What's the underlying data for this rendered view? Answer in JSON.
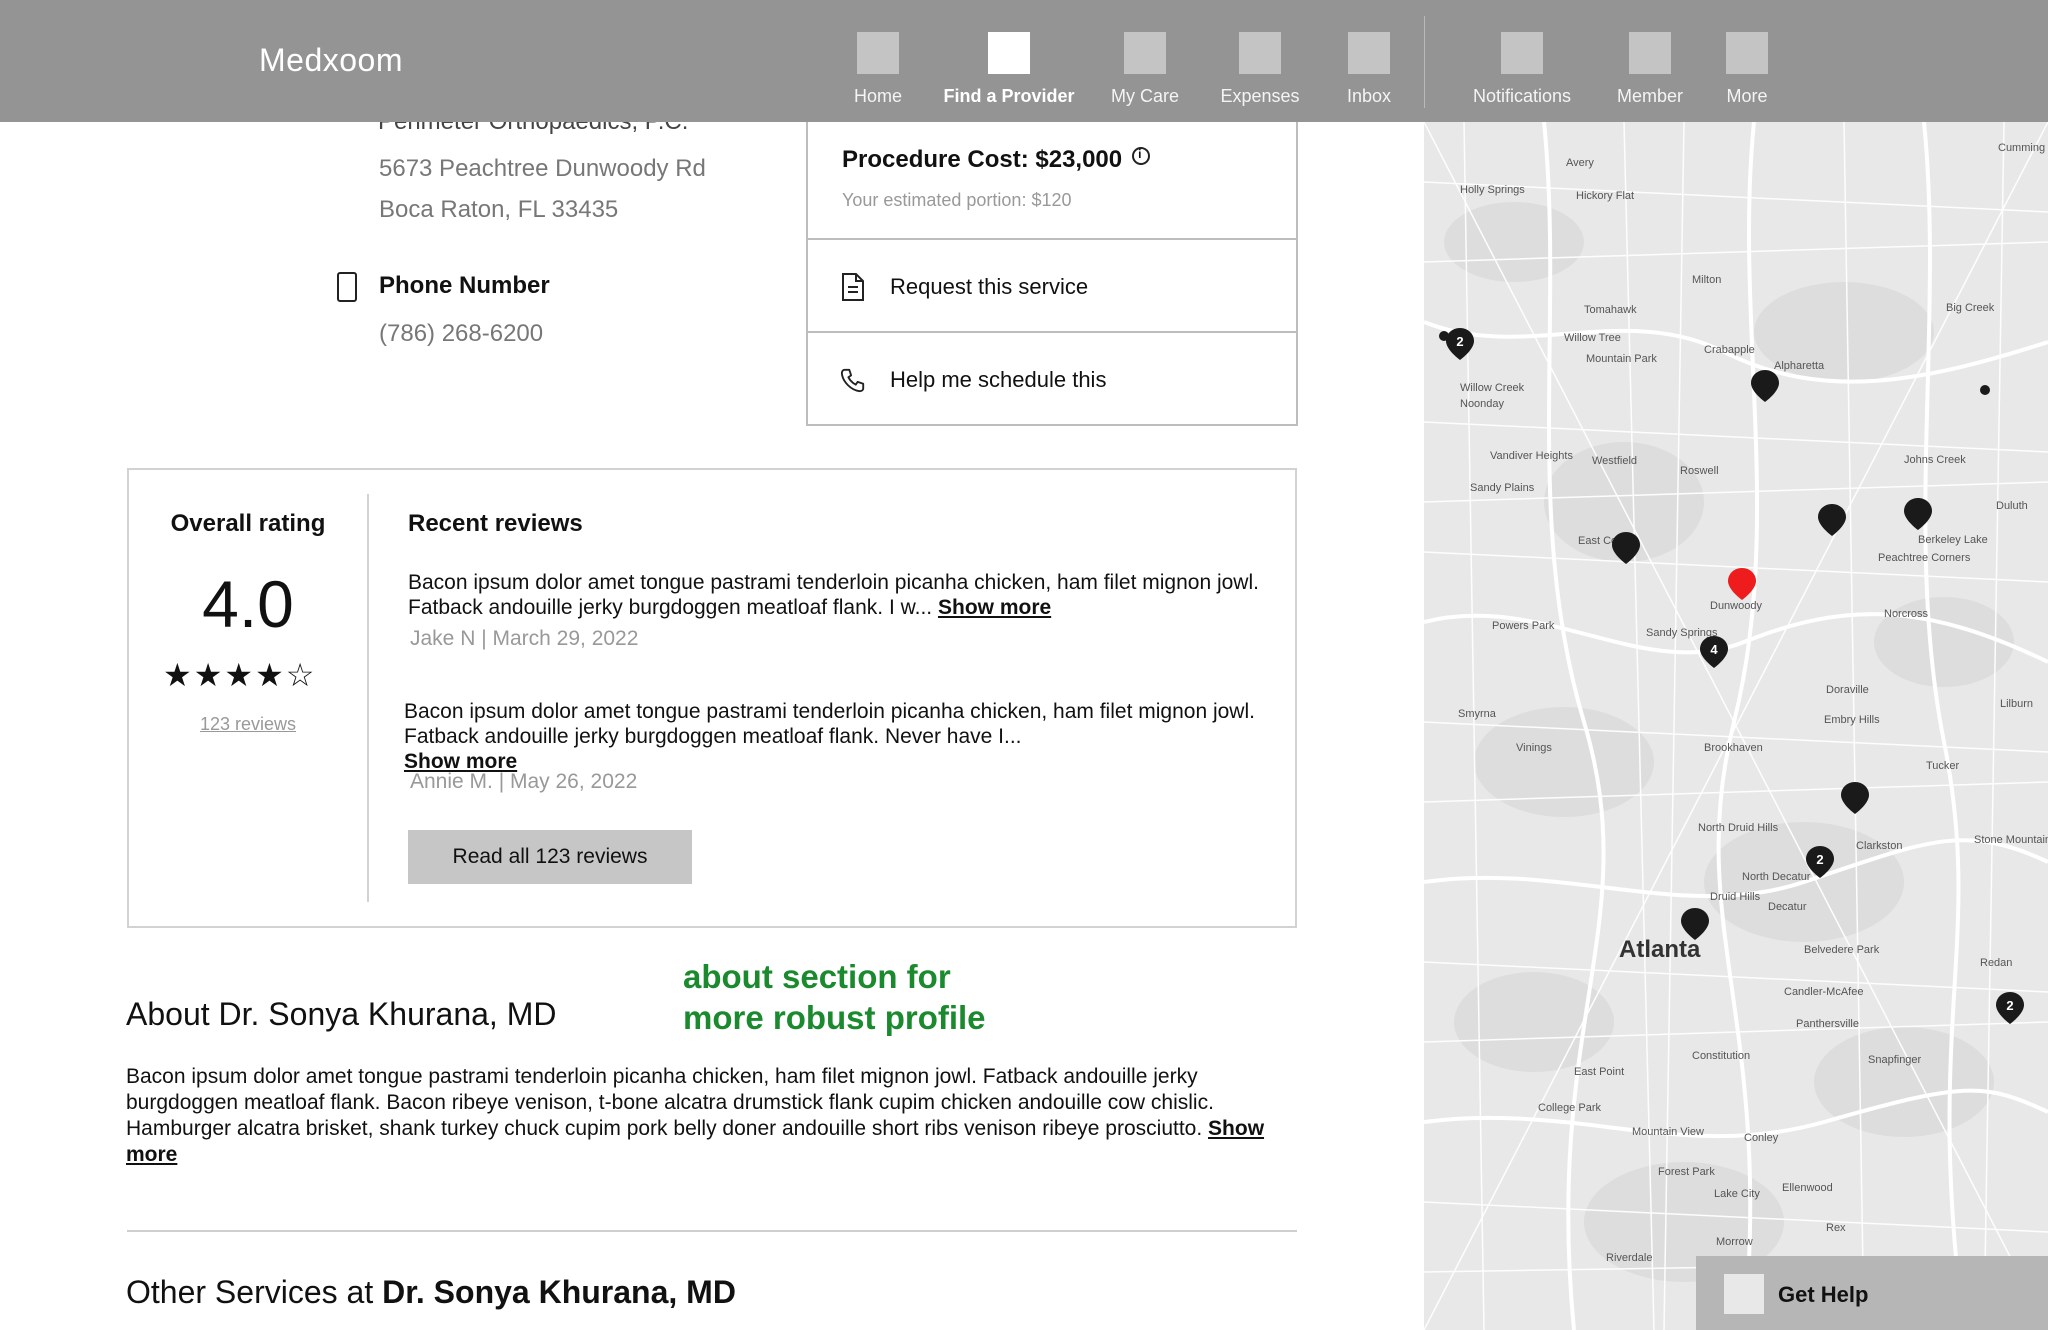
{
  "app": {
    "name": "Medxoom"
  },
  "nav": {
    "items": [
      {
        "label": "Home",
        "active": false
      },
      {
        "label": "Find a Provider",
        "active": true
      },
      {
        "label": "My Care",
        "active": false
      },
      {
        "label": "Expenses",
        "active": false
      },
      {
        "label": "Inbox",
        "active": false
      },
      {
        "label": "Notifications",
        "active": false
      },
      {
        "label": "Member",
        "active": false
      },
      {
        "label": "More",
        "active": false
      }
    ]
  },
  "provider": {
    "clinic_name_clipped": "Perimeter Orthopaedics, P.C.",
    "address_line1": "5673 Peachtree Dunwoody Rd",
    "address_line2": "Boca Raton, FL 33435",
    "phone_title": "Phone Number",
    "phone": "(786) 268-6200"
  },
  "cost": {
    "title": "Procedure Cost: $23,000",
    "subtitle": "Your estimated portion: $120",
    "actions": [
      {
        "label": "Request this service",
        "icon": "document-icon"
      },
      {
        "label": "Help me schedule this",
        "icon": "phone-icon"
      }
    ]
  },
  "ratings": {
    "overall_title": "Overall rating",
    "overall_value": "4.0",
    "stars": 4,
    "stars_max": 5,
    "review_count": "123 reviews",
    "recent_title": "Recent reviews",
    "reviews": [
      {
        "text": "Bacon ipsum dolor amet tongue pastrami tenderloin picanha chicken, ham filet mignon jowl. Fatback andouille jerky burgdoggen meatloaf flank. I w...",
        "show_more": "Show more",
        "author": "Jake N",
        "date": "March 29, 2022"
      },
      {
        "text": "Bacon ipsum dolor amet tongue pastrami tenderloin picanha chicken, ham filet mignon jowl. Fatback andouille jerky burgdoggen meatloaf flank. Never have I...",
        "show_more": "Show more",
        "author": "Annie M.",
        "date": "May 26, 2022"
      }
    ],
    "read_all": "Read all 123 reviews"
  },
  "about": {
    "title": "About Dr. Sonya Khurana, MD",
    "annotation_line1": "about section for",
    "annotation_line2": "more robust profile",
    "text": "Bacon ipsum dolor amet tongue pastrami tenderloin picanha chicken, ham filet mignon jowl. Fatback andouille jerky burgdoggen meatloaf flank. Bacon ribeye venison, t-bone alcatra drumstick flank cupim chicken andouille cow chislic. Hamburger alcatra brisket, shank turkey chuck cupim pork belly doner andouille short ribs venison ribeye prosciutto.",
    "show_more": "Show more"
  },
  "other_services": {
    "prefix": "Other Services at",
    "name": "Dr. Sonya Khurana, MD"
  },
  "map": {
    "city_label": "Atlanta",
    "place_labels": [
      "Avery",
      "Holly Springs",
      "Hickory Flat",
      "Cumming",
      "Milton",
      "Big Creek",
      "Tomahawk",
      "Willow Tree",
      "Crabapple",
      "Mountain Park",
      "Willow Creek",
      "Noonday",
      "Alpharetta",
      "Westfield",
      "Roswell",
      "Vandiver Heights",
      "Sandy Plains",
      "Johns Creek",
      "Duluth",
      "East Cobb",
      "Berkeley Lake",
      "Peachtree Corners",
      "Dunwoody",
      "Norcross",
      "Powers Park",
      "Sandy Springs",
      "Doraville",
      "Smyrna",
      "Embry Hills",
      "Vinings",
      "Brookhaven",
      "Tucker",
      "Clarkston",
      "North Druid Hills",
      "Stone Mountain",
      "North Decatur",
      "Druid Hills",
      "Decatur",
      "Belvedere Park",
      "Candler-McAfee",
      "Panthersville",
      "Redan",
      "Constitution",
      "Snapfinger",
      "East Point",
      "College Park",
      "Mountain View",
      "Conley",
      "Forest Park",
      "Lake City",
      "Ellenwood",
      "Rex",
      "Morrow",
      "Riverdale",
      "Lilburn"
    ],
    "cluster_counts": [
      "2",
      "4",
      "2",
      "2"
    ],
    "pin_color_selected": "#ee1c1c",
    "pin_color": "#1a1a1a"
  },
  "help": {
    "label": "Get Help"
  }
}
